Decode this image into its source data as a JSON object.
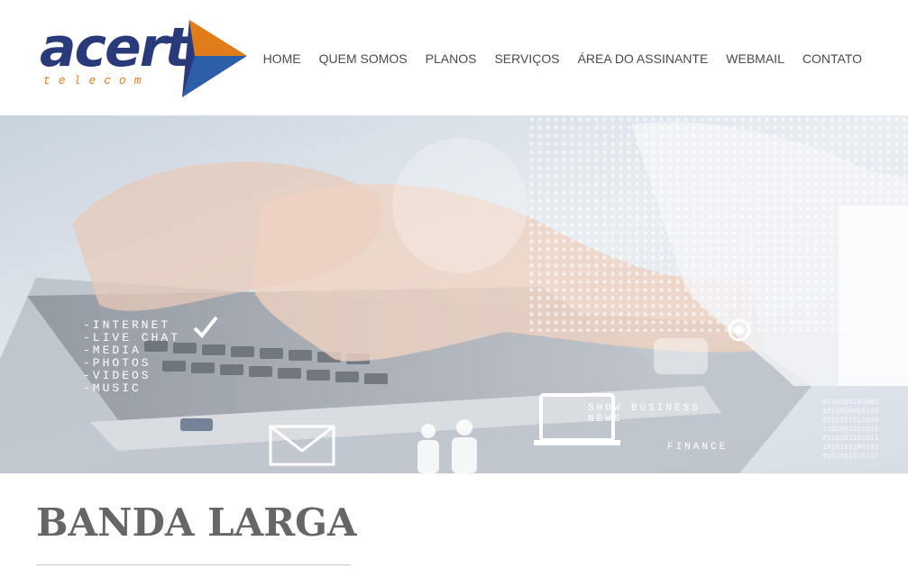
{
  "brand": {
    "name": "acert",
    "tagline": "telecom",
    "colors": {
      "navy": "#283a7a",
      "orange": "#e07c1a",
      "blue": "#2d5fa8"
    }
  },
  "nav": {
    "items": [
      {
        "label": "HOME"
      },
      {
        "label": "QUEM SOMOS"
      },
      {
        "label": "PLANOS"
      },
      {
        "label": "SERVIÇOS"
      },
      {
        "label": "ÁREA DO ASSINANTE"
      },
      {
        "label": "WEBMAIL"
      },
      {
        "label": "CONTATO"
      }
    ]
  },
  "hero": {
    "overlay_list": [
      "-INTERNET",
      "-LIVE CHAT",
      "-MEDIA",
      "-PHOTOS",
      "-VIDEOS",
      "-MUSIC"
    ],
    "overlay_show": "SHOW BUSINESS",
    "overlay_news": "NEWS",
    "overlay_finance": "FINANCE"
  },
  "page": {
    "title": "BANDA LARGA"
  }
}
